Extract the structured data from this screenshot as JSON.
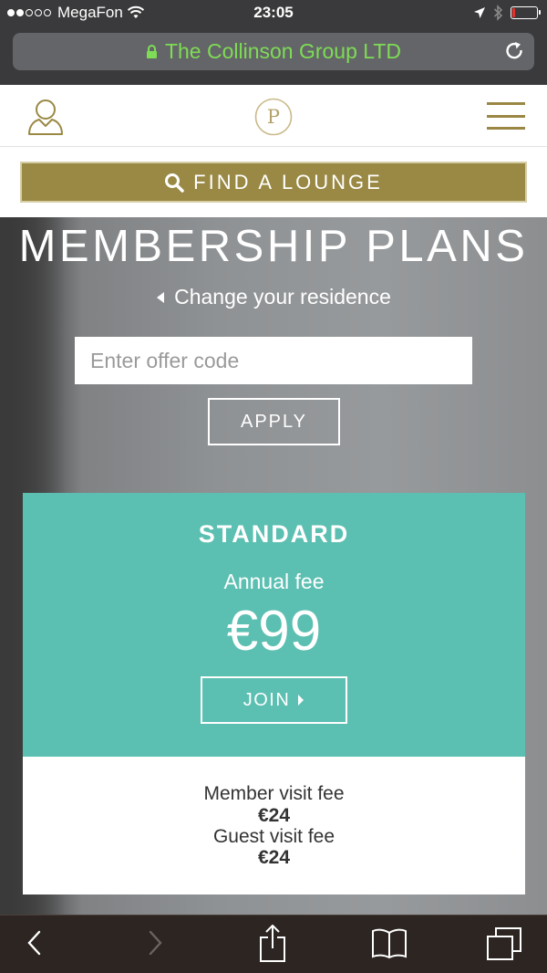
{
  "status_bar": {
    "carrier": "MegaFon",
    "time": "23:05",
    "battery_level": 0.12,
    "battery_color": "#e6302b"
  },
  "browser": {
    "url_text": "The Collinson Group LTD",
    "url_color": "#7edc56",
    "lock_icon": "lock-icon",
    "refresh_icon": "refresh-icon"
  },
  "header": {
    "logo_letter": "P",
    "accent_color": "#998944",
    "find_lounge_label": "FIND A LOUNGE"
  },
  "hero": {
    "title": "MEMBERSHIP PLANS",
    "residence_link": "Change your residence",
    "offer_placeholder": "Enter offer code",
    "apply_label": "APPLY"
  },
  "plan": {
    "name": "STANDARD",
    "fee_label": "Annual fee",
    "price": "€99",
    "join_label": "JOIN",
    "color": "#5bbfb1",
    "member_fee_label": "Member visit fee",
    "member_fee_value": "€24",
    "guest_fee_label": "Guest visit fee",
    "guest_fee_value": "€24"
  },
  "toolbar": {
    "icons": [
      "back-icon",
      "forward-icon",
      "share-icon",
      "bookmarks-icon",
      "tabs-icon"
    ]
  }
}
